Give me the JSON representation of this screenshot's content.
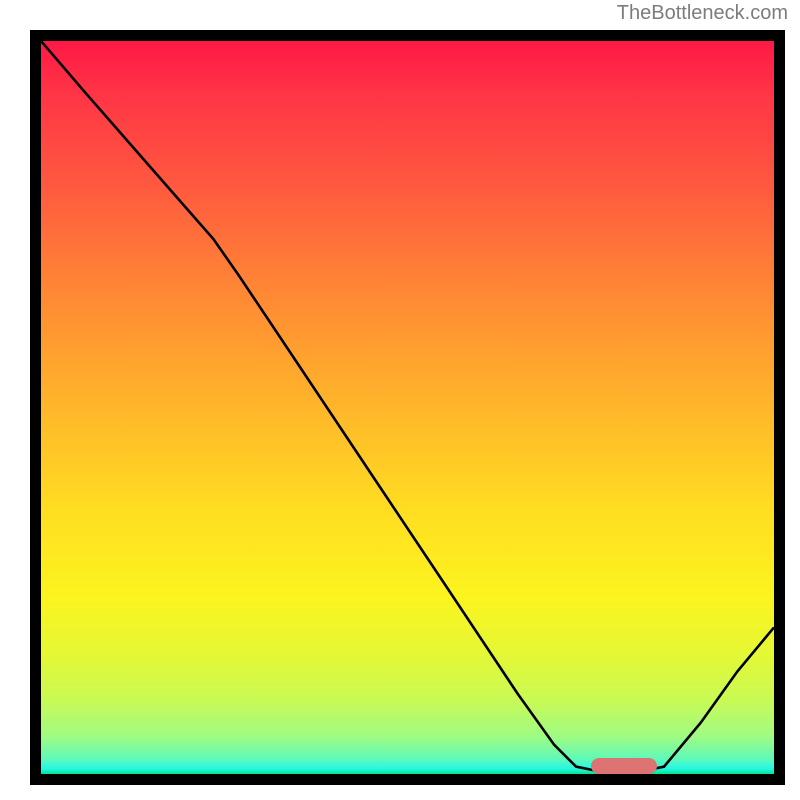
{
  "watermark": "TheBottleneck.com",
  "chart_data": {
    "type": "line",
    "title": "",
    "xlabel": "",
    "ylabel": "",
    "xlim": [
      0,
      100
    ],
    "ylim": [
      0,
      100
    ],
    "note": "No axis labels or tick labels are visible in the image; numeric values are normalized 0-100 estimates from pixel positions.",
    "series": [
      {
        "name": "curve",
        "points": [
          {
            "x": 0,
            "y": 100
          },
          {
            "x": 6,
            "y": 93
          },
          {
            "x": 13,
            "y": 85
          },
          {
            "x": 20,
            "y": 77
          },
          {
            "x": 23.5,
            "y": 73
          },
          {
            "x": 27,
            "y": 68
          },
          {
            "x": 35,
            "y": 56
          },
          {
            "x": 45,
            "y": 41
          },
          {
            "x": 55,
            "y": 26
          },
          {
            "x": 65,
            "y": 11
          },
          {
            "x": 70,
            "y": 4
          },
          {
            "x": 73,
            "y": 1
          },
          {
            "x": 76,
            "y": 0.4
          },
          {
            "x": 82,
            "y": 0.4
          },
          {
            "x": 85,
            "y": 1
          },
          {
            "x": 90,
            "y": 7
          },
          {
            "x": 95,
            "y": 14
          },
          {
            "x": 100,
            "y": 20
          }
        ]
      }
    ],
    "marker": {
      "name": "optimal-range",
      "x_start": 75,
      "x_end": 84,
      "y": 0.5,
      "color": "#dd7373"
    },
    "background_gradient": {
      "top": "#ff1846",
      "mid": "#ffe021",
      "bottom": "#00e58a"
    }
  }
}
